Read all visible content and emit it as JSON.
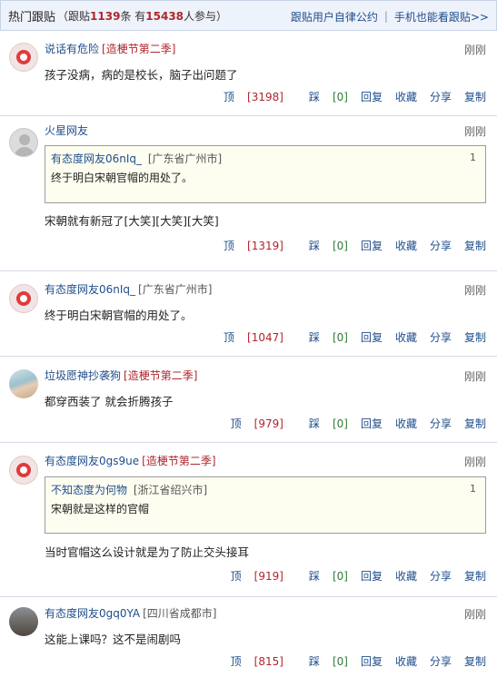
{
  "header": {
    "title": "热门跟贴",
    "stats_prefix": "（跟贴",
    "reply_count": "1139",
    "stats_mid": "条 有",
    "participant_count": "15438",
    "stats_suffix": "人参与）",
    "link1": "跟贴用户自律公约",
    "link2": "手机也能看跟贴>>"
  },
  "actions": {
    "up": "顶",
    "down": "踩",
    "reply": "回复",
    "fav": "收藏",
    "share": "分享",
    "copy": "复制"
  },
  "comments": [
    {
      "user": "说话有危险",
      "location": "",
      "tag": "[造梗节第二季]",
      "time": "刚刚",
      "text": "孩子没病，病的是校长，脑子出问题了",
      "up": "[3198]",
      "down": "[0]"
    },
    {
      "user": "火星网友",
      "location": "",
      "tag": "",
      "time": "刚刚",
      "quote": {
        "user": "有态度网友06nIq_",
        "location": "[广东省广州市]",
        "floor": "1",
        "text": "终于明白宋朝官帽的用处了。"
      },
      "text": "宋朝就有新冠了[大笑][大笑][大笑]",
      "up": "[1319]",
      "down": "[0]"
    },
    {
      "user": "有态度网友06nIq_",
      "location": "[广东省广州市]",
      "tag": "",
      "time": "刚刚",
      "text": "终于明白宋朝官帽的用处了。",
      "up": "[1047]",
      "down": "[0]"
    },
    {
      "user": "垃圾愿神抄袭狗",
      "location": "",
      "tag": "[造梗节第二季]",
      "time": "刚刚",
      "text": "都穿西装了 就会折腾孩子",
      "up": "[979]",
      "down": "[0]"
    },
    {
      "user": "有态度网友0gs9ue",
      "location": "",
      "tag": "[造梗节第二季]",
      "time": "刚刚",
      "quote": {
        "user": "不知态度为何物",
        "location": "[浙江省绍兴市]",
        "floor": "1",
        "text": "宋朝就是这样的官帽"
      },
      "text": "当时官帽这么设计就是为了防止交头接耳",
      "up": "[919]",
      "down": "[0]"
    },
    {
      "user": "有态度网友0gq0YA",
      "location": "[四川省成都市]",
      "tag": "",
      "time": "刚刚",
      "text": "这能上课吗？这不是闹剧吗",
      "up": "[815]",
      "down": "[0]"
    }
  ]
}
